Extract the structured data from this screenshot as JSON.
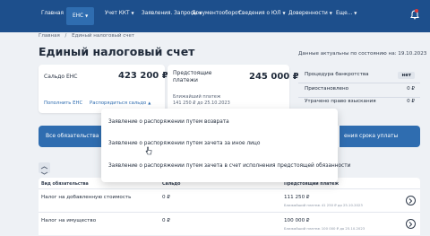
{
  "nav": {
    "items": [
      "Главная",
      "ЕНС",
      "Учет ККТ",
      "Заявления. Запросы",
      "Документооборот",
      "Сведения о ЮЛ",
      "Доверенности",
      "Еще..."
    ]
  },
  "breadcrumb": {
    "home": "Главная",
    "sep": "/",
    "current": "Единый налоговый счет"
  },
  "page": {
    "title": "Единый налоговый счет",
    "actual_note": "Данные актуальны по состоянию на: 19.10.2023"
  },
  "balance": {
    "label": "Сальдо ЕНС",
    "amount": "423 200 ₽",
    "refill_link": "Пополнить ЕНС",
    "dispose_link": "Распорядиться сальдо"
  },
  "upcoming": {
    "label_line1": "Предстоящие",
    "label_line2": "платежи",
    "amount": "245 000 ₽",
    "nearest_label": "Ближайший платеж",
    "nearest_value": "141 250 ₽ до 25.10.2023"
  },
  "bankruptcy": {
    "rows": [
      {
        "label": "Процедура банкротства",
        "value": "нет"
      },
      {
        "label": "Приостановлено",
        "value": "0 ₽"
      },
      {
        "label": "Утрачено право взыскания",
        "value": "0 ₽"
      }
    ]
  },
  "tabs": {
    "all": "Все обязательства",
    "deadline": "ения срока уплаты"
  },
  "table": {
    "headers": {
      "type": "Вид обязательства",
      "saldo": "Сальдо",
      "upcoming": "Предстоящий платеж"
    },
    "rows": [
      {
        "name": "Налог на добавленную стоимость",
        "saldo": "0 ₽",
        "payment": "111 250 ₽",
        "note": "Ближайший платеж 41 250 ₽ до 25.10.2023"
      },
      {
        "name": "Налог на имущество",
        "saldo": "0 ₽",
        "payment": "100 000 ₽",
        "note": "Ближайший платеж 100 000 ₽ до 25.10.2023"
      }
    ]
  },
  "dropdown": {
    "items": [
      "Заявление о распоряжении путем возврата",
      "Заявление о распоряжении путем зачета за иное лицо",
      "Заявление о распоряжении путем зачета в счет исполнения предстоящей обязанности"
    ]
  },
  "icons": {
    "notifications": "bell-icon",
    "row_action": "chevron-right-circle-icon",
    "sort": "sort-icon"
  },
  "colors": {
    "nav_bg": "#1d4f8c",
    "accent": "#2f6db0",
    "page_bg": "#eef1f5",
    "notification_dot": "#e23b3b"
  }
}
